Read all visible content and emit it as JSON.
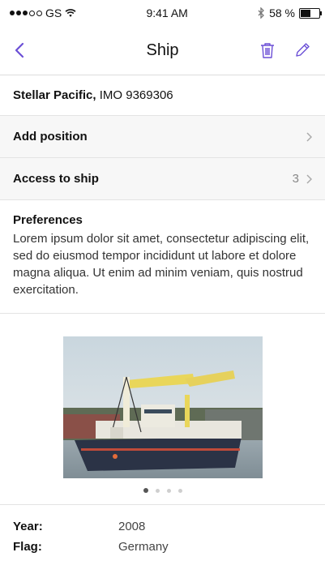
{
  "status_bar": {
    "carrier": "GS",
    "time": "9:41 AM",
    "battery_text": "58 %",
    "battery_level": 0.58
  },
  "nav": {
    "title": "Ship",
    "back_icon": "chevron-left-icon",
    "delete_icon": "trash-icon",
    "edit_icon": "pencil-icon",
    "accent_color": "#6b4fd6"
  },
  "ship": {
    "name": "Stellar Pacific,",
    "imo": " IMO 9369306"
  },
  "rows": {
    "add_position": {
      "label": "Add position"
    },
    "access": {
      "label": "Access to ship",
      "count": "3"
    }
  },
  "preferences": {
    "title": "Preferences",
    "text": "Lorem ipsum dolor sit amet, consectetur adipiscing elit, sed do eiusmod tempor incididunt ut labore et dolore magna aliqua. Ut enim ad minim veniam, quis nostrud exercitation."
  },
  "gallery": {
    "pages": 4,
    "current_page": 1
  },
  "details": {
    "year_label": "Year:",
    "year_value": "2008",
    "flag_label": "Flag:",
    "flag_value": "Germany"
  }
}
